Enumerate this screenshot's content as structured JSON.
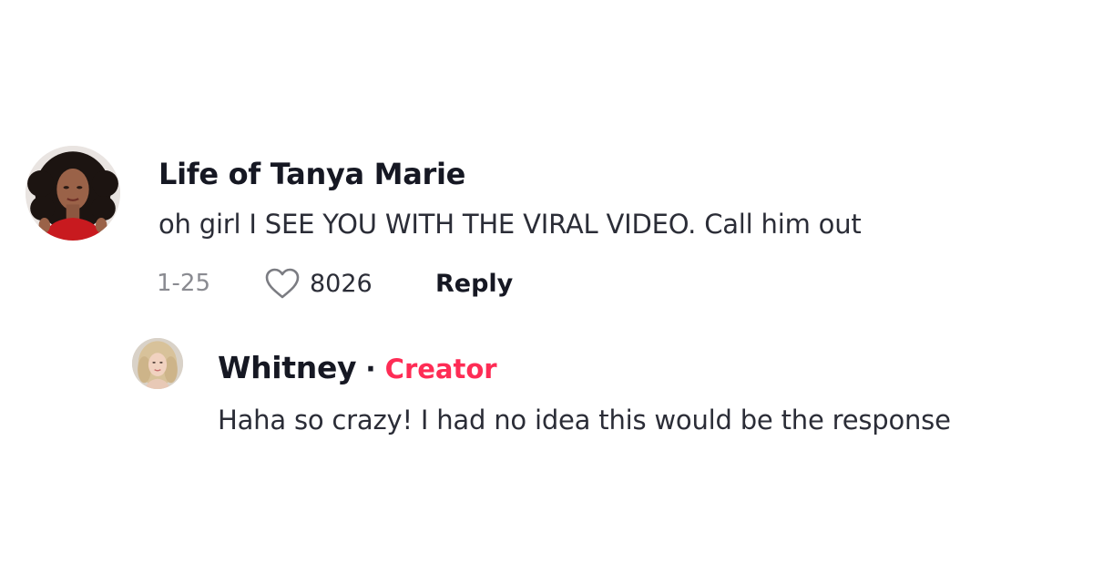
{
  "comment": {
    "author": "Life of Tanya Marie",
    "text": "oh girl I SEE YOU WITH THE VIRAL VIDEO. Call him out",
    "date": "1-25",
    "like_count": "8026",
    "reply_label": "Reply",
    "avatar_icon": "profile-photo"
  },
  "reply": {
    "author": "Whitney",
    "separator": "·",
    "badge": "Creator",
    "text": "Haha so crazy! I had no idea this would be the response",
    "avatar_icon": "profile-photo"
  },
  "colors": {
    "text_primary": "#161823",
    "text_secondary": "#8a8b91",
    "creator_accent": "#fe2c55",
    "background": "#ffffff"
  },
  "icons": {
    "like": "heart-outline-icon"
  }
}
